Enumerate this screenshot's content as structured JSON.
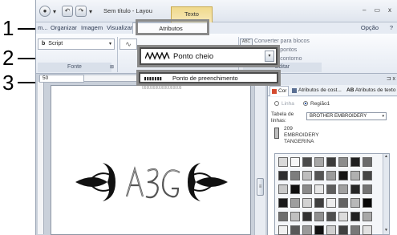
{
  "callouts": [
    "1",
    "2",
    "3"
  ],
  "titlebar": {
    "title": "Sem título - Layou",
    "context_tab": "Texto",
    "window_controls": [
      "–",
      "▭",
      "x"
    ]
  },
  "ribbon_tabs": {
    "partial_tab": "m...",
    "organize": "Organizar",
    "image": "Imagem",
    "view": "Visualizar",
    "attributes": "Atributos",
    "option": "Opção",
    "help": "?"
  },
  "ribbon": {
    "font_name": "Script",
    "font_icon": "b",
    "font_group": "Fonte",
    "size_value": "50",
    "group_launcher": "⊠",
    "convert": {
      "to_blocks": "Converter para blocos",
      "to_points": "erter para pontos",
      "to_outline": "erter para contorno"
    },
    "edit_group": "Editar"
  },
  "stitch_dropdown": {
    "selected": "Ponto cheio",
    "option_fill": "Ponto de preenchimento"
  },
  "side_panel": {
    "tabs": {
      "color": "Cor",
      "stitch_attrs": "Atributos de cost...",
      "text_attrs": "Atributos de texto",
      "text_attrs_icon": "AB"
    },
    "radio_line": "Linha",
    "radio_region": "Região1",
    "table_label_1": "Tabela de",
    "table_label_2": "linhas:",
    "table_value": "BROTHER EMBROIDERY",
    "color_number": "209",
    "color_brand": "EMBROIDERY",
    "color_name": "TANGERINA"
  },
  "palette_colors": [
    "#d9d9d9",
    "#f7f7f7",
    "#4a4a4a",
    "#a6a6a6",
    "#3b3b3b",
    "#8c8c8c",
    "#1e1e1e",
    "#6b6b6b",
    "#2f2f2f",
    "#7d7d7d",
    "#bdbdbd",
    "#555555",
    "#9b9b9b",
    "#141414",
    "#b0b0b0",
    "#444444",
    "#c8c8c8",
    "#0f0f0f",
    "#8a8a8a",
    "#e6e6e6",
    "#5e5e5e",
    "#a0a0a0",
    "#262626",
    "#737373",
    "#1a1a1a",
    "#9e9e9e",
    "#d2d2d2",
    "#3e3e3e",
    "#ededed",
    "#636363",
    "#b8b8b8",
    "#080808",
    "#6e6e6e",
    "#c0c0c0",
    "#323232",
    "#8f8f8f",
    "#4f4f4f",
    "#dcdcdc",
    "#202020",
    "#a8a8a8",
    "#f0f0f0",
    "#585858",
    "#9a9a9a",
    "#121212",
    "#cfcfcf",
    "#404040",
    "#787878",
    "#e1e1e1"
  ]
}
